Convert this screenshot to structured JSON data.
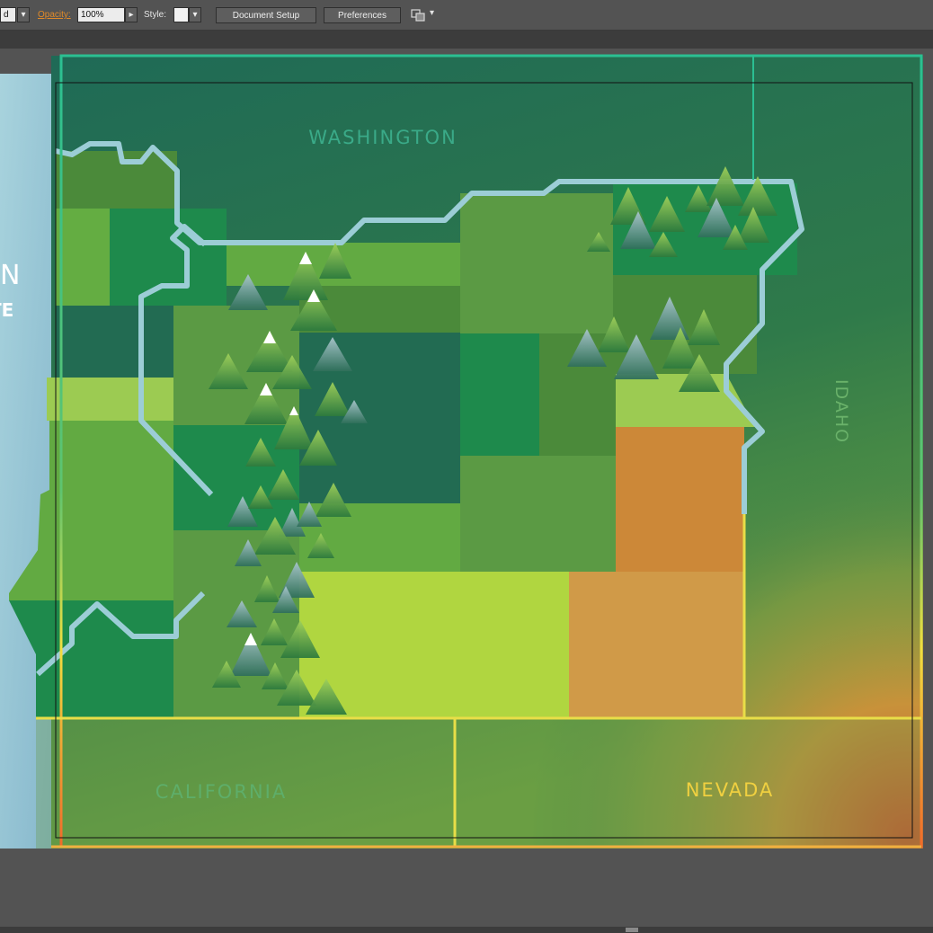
{
  "toolbar": {
    "partial_field_value": "d",
    "opacity_label": "Opacity:",
    "opacity_value": "100%",
    "style_label": "Style:",
    "document_setup_label": "Document Setup",
    "preferences_label": "Preferences",
    "arrange_icon": "arrange-documents-icon",
    "dropdown_arrow": "▾",
    "play_arrow": "▸"
  },
  "map": {
    "neighbor_labels": {
      "north": "WASHINGTON",
      "south_west": "CALIFORNIA",
      "south_east": "NEVADA",
      "east": "IDAHO"
    },
    "left_panel_partial_text": [
      "N",
      "TE"
    ]
  },
  "colors": {
    "ui_background": "#535353",
    "accent_label": "#e08a28",
    "ocean": "#9cc8d8",
    "state_border": "#9ccdd6",
    "frame_teal": "#2bbf92",
    "frame_yellow": "#f0de40",
    "frame_orange": "#f06a2a"
  }
}
